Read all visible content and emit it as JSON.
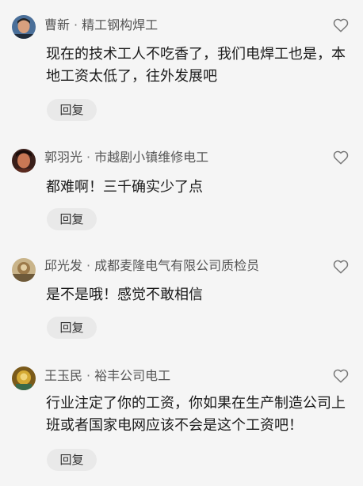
{
  "comments": [
    {
      "name": "曹新",
      "separator": "·",
      "title": "精工钢构焊工",
      "body_lines": [
        "现在的技术工人不吃香了，我们电焊工也是，本",
        "地工资太低了，往外发展吧"
      ],
      "reply_label": "回复",
      "avatar_icon": "avatar-man-icon"
    },
    {
      "name": "郭羽光",
      "separator": "·",
      "title": "市越剧小镇维修电工",
      "body_lines": [
        "都难啊！三千确实少了点"
      ],
      "reply_label": "回复",
      "avatar_icon": "avatar-portrait-icon"
    },
    {
      "name": "邱光发",
      "separator": "·",
      "title": "成都麦隆电气有限公司质检员",
      "body_lines": [
        "是不是哦！感觉不敢相信"
      ],
      "reply_label": "回复",
      "avatar_icon": "avatar-landscape-icon"
    },
    {
      "name": "王玉民",
      "separator": "·",
      "title": "裕丰公司电工",
      "body_lines": [
        "行业注定了你的工资，你如果在生产制造公司上",
        "班或者国家电网应该不会是这个工资吧！"
      ],
      "reply_label": "回复",
      "avatar_icon": "avatar-golden-icon"
    }
  ],
  "like_icon": "heart-outline-icon",
  "colors": {
    "background": "#f5f5f5",
    "meta_text": "#555555",
    "body_text": "#1a1a1a",
    "reply_bg": "#e9e9e9"
  }
}
